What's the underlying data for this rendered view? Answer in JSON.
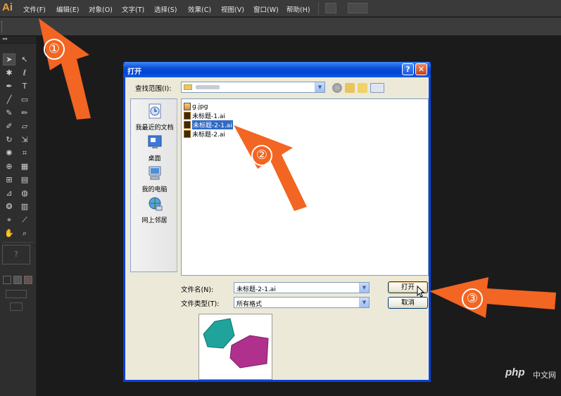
{
  "app": {
    "logo": "Ai"
  },
  "menu": {
    "items": [
      "文件(F)",
      "编辑(E)",
      "对象(O)",
      "文字(T)",
      "选择(S)",
      "效果(C)",
      "视图(V)",
      "窗口(W)",
      "帮助(H)"
    ]
  },
  "dialog": {
    "title": "打开",
    "help_glyph": "?",
    "close_glyph": "✕",
    "look_in_label": "查找范围(I):",
    "places": [
      {
        "label": "我最近的文档",
        "icon": "recent-documents-icon"
      },
      {
        "label": "桌面",
        "icon": "desktop-icon"
      },
      {
        "label": "我的电脑",
        "icon": "my-computer-icon"
      },
      {
        "label": "网上邻居",
        "icon": "network-icon"
      }
    ],
    "files": [
      {
        "name": "g.jpg",
        "selected": false
      },
      {
        "name": "未标题-1.ai",
        "selected": false
      },
      {
        "name": "未标题-2-1.ai",
        "selected": true
      },
      {
        "name": "未标题-2.ai",
        "selected": false
      }
    ],
    "filename_label": "文件名(N):",
    "filename_value": "未标题-2-1.ai",
    "filetype_label": "文件类型(T):",
    "filetype_value": "所有格式",
    "open_button": "打开",
    "cancel_button": "取消"
  },
  "annotations": {
    "step1": "①",
    "step2": "②",
    "step3": "③",
    "accent_color": "#f26522"
  },
  "watermark": {
    "brand": "php",
    "suffix": "中文网"
  }
}
